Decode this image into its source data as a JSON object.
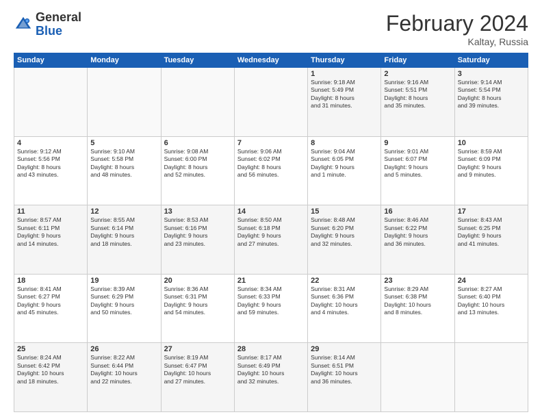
{
  "header": {
    "logo_general": "General",
    "logo_blue": "Blue",
    "title": "February 2024",
    "subtitle": "Kaltay, Russia"
  },
  "weekdays": [
    "Sunday",
    "Monday",
    "Tuesday",
    "Wednesday",
    "Thursday",
    "Friday",
    "Saturday"
  ],
  "weeks": [
    [
      {
        "day": "",
        "info": ""
      },
      {
        "day": "",
        "info": ""
      },
      {
        "day": "",
        "info": ""
      },
      {
        "day": "",
        "info": ""
      },
      {
        "day": "1",
        "info": "Sunrise: 9:18 AM\nSunset: 5:49 PM\nDaylight: 8 hours\nand 31 minutes."
      },
      {
        "day": "2",
        "info": "Sunrise: 9:16 AM\nSunset: 5:51 PM\nDaylight: 8 hours\nand 35 minutes."
      },
      {
        "day": "3",
        "info": "Sunrise: 9:14 AM\nSunset: 5:54 PM\nDaylight: 8 hours\nand 39 minutes."
      }
    ],
    [
      {
        "day": "4",
        "info": "Sunrise: 9:12 AM\nSunset: 5:56 PM\nDaylight: 8 hours\nand 43 minutes."
      },
      {
        "day": "5",
        "info": "Sunrise: 9:10 AM\nSunset: 5:58 PM\nDaylight: 8 hours\nand 48 minutes."
      },
      {
        "day": "6",
        "info": "Sunrise: 9:08 AM\nSunset: 6:00 PM\nDaylight: 8 hours\nand 52 minutes."
      },
      {
        "day": "7",
        "info": "Sunrise: 9:06 AM\nSunset: 6:02 PM\nDaylight: 8 hours\nand 56 minutes."
      },
      {
        "day": "8",
        "info": "Sunrise: 9:04 AM\nSunset: 6:05 PM\nDaylight: 9 hours\nand 1 minute."
      },
      {
        "day": "9",
        "info": "Sunrise: 9:01 AM\nSunset: 6:07 PM\nDaylight: 9 hours\nand 5 minutes."
      },
      {
        "day": "10",
        "info": "Sunrise: 8:59 AM\nSunset: 6:09 PM\nDaylight: 9 hours\nand 9 minutes."
      }
    ],
    [
      {
        "day": "11",
        "info": "Sunrise: 8:57 AM\nSunset: 6:11 PM\nDaylight: 9 hours\nand 14 minutes."
      },
      {
        "day": "12",
        "info": "Sunrise: 8:55 AM\nSunset: 6:14 PM\nDaylight: 9 hours\nand 18 minutes."
      },
      {
        "day": "13",
        "info": "Sunrise: 8:53 AM\nSunset: 6:16 PM\nDaylight: 9 hours\nand 23 minutes."
      },
      {
        "day": "14",
        "info": "Sunrise: 8:50 AM\nSunset: 6:18 PM\nDaylight: 9 hours\nand 27 minutes."
      },
      {
        "day": "15",
        "info": "Sunrise: 8:48 AM\nSunset: 6:20 PM\nDaylight: 9 hours\nand 32 minutes."
      },
      {
        "day": "16",
        "info": "Sunrise: 8:46 AM\nSunset: 6:22 PM\nDaylight: 9 hours\nand 36 minutes."
      },
      {
        "day": "17",
        "info": "Sunrise: 8:43 AM\nSunset: 6:25 PM\nDaylight: 9 hours\nand 41 minutes."
      }
    ],
    [
      {
        "day": "18",
        "info": "Sunrise: 8:41 AM\nSunset: 6:27 PM\nDaylight: 9 hours\nand 45 minutes."
      },
      {
        "day": "19",
        "info": "Sunrise: 8:39 AM\nSunset: 6:29 PM\nDaylight: 9 hours\nand 50 minutes."
      },
      {
        "day": "20",
        "info": "Sunrise: 8:36 AM\nSunset: 6:31 PM\nDaylight: 9 hours\nand 54 minutes."
      },
      {
        "day": "21",
        "info": "Sunrise: 8:34 AM\nSunset: 6:33 PM\nDaylight: 9 hours\nand 59 minutes."
      },
      {
        "day": "22",
        "info": "Sunrise: 8:31 AM\nSunset: 6:36 PM\nDaylight: 10 hours\nand 4 minutes."
      },
      {
        "day": "23",
        "info": "Sunrise: 8:29 AM\nSunset: 6:38 PM\nDaylight: 10 hours\nand 8 minutes."
      },
      {
        "day": "24",
        "info": "Sunrise: 8:27 AM\nSunset: 6:40 PM\nDaylight: 10 hours\nand 13 minutes."
      }
    ],
    [
      {
        "day": "25",
        "info": "Sunrise: 8:24 AM\nSunset: 6:42 PM\nDaylight: 10 hours\nand 18 minutes."
      },
      {
        "day": "26",
        "info": "Sunrise: 8:22 AM\nSunset: 6:44 PM\nDaylight: 10 hours\nand 22 minutes."
      },
      {
        "day": "27",
        "info": "Sunrise: 8:19 AM\nSunset: 6:47 PM\nDaylight: 10 hours\nand 27 minutes."
      },
      {
        "day": "28",
        "info": "Sunrise: 8:17 AM\nSunset: 6:49 PM\nDaylight: 10 hours\nand 32 minutes."
      },
      {
        "day": "29",
        "info": "Sunrise: 8:14 AM\nSunset: 6:51 PM\nDaylight: 10 hours\nand 36 minutes."
      },
      {
        "day": "",
        "info": ""
      },
      {
        "day": "",
        "info": ""
      }
    ]
  ]
}
